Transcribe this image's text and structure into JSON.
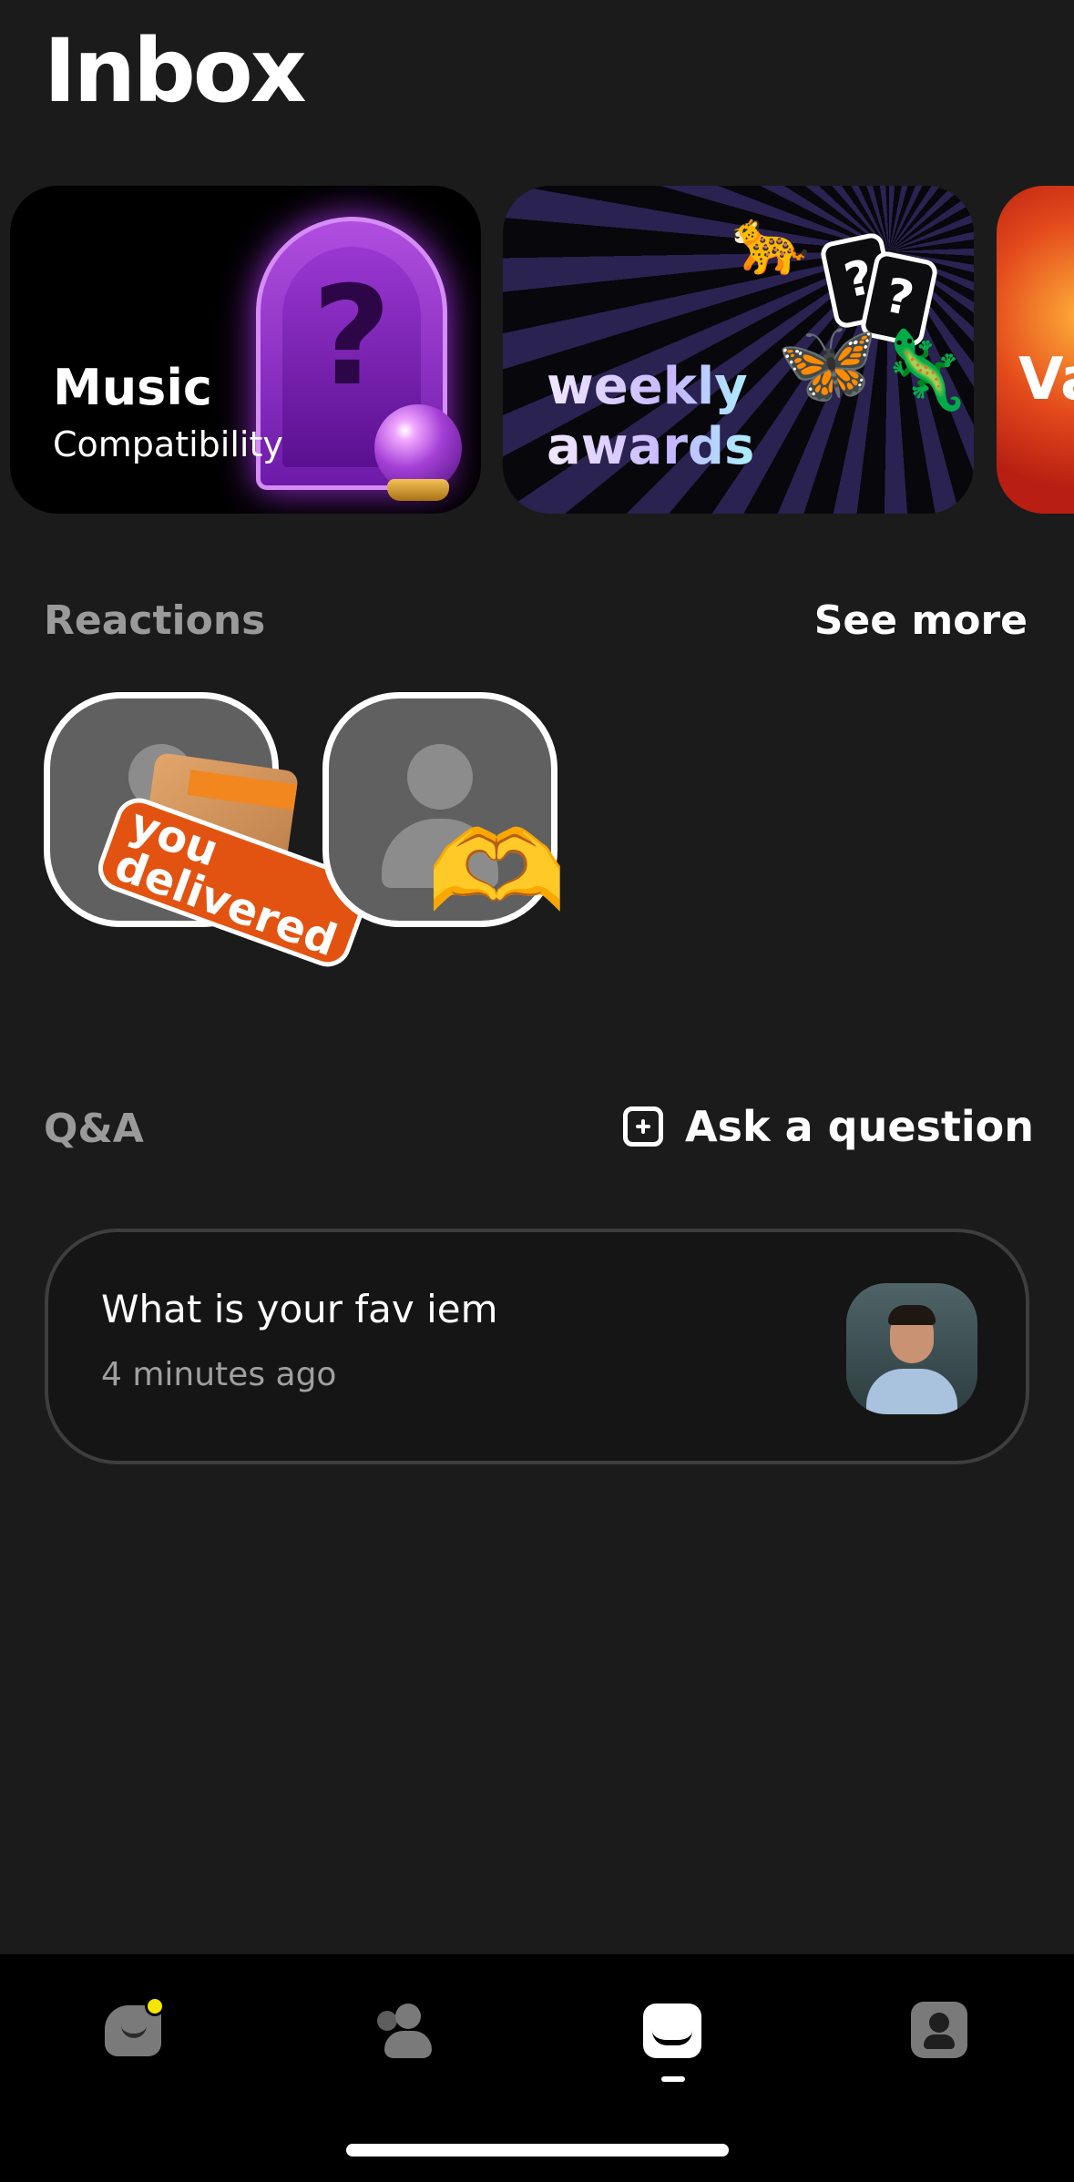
{
  "header": {
    "title": "Inbox"
  },
  "cards": [
    {
      "title": "Music",
      "subtitle": "Compatibility",
      "icon": "question-arch-icon"
    },
    {
      "title": "weekly awards",
      "title_line1": "weekly",
      "title_line2": "awards",
      "icon": "question-cards-icon"
    },
    {
      "title_partial": "Va"
    }
  ],
  "reactions": {
    "label": "Reactions",
    "see_more": "See more",
    "items": [
      {
        "sticker": "you delivered",
        "sticker_line1": "you",
        "sticker_line2": "delivered",
        "icon": "amazon-box-icon"
      },
      {
        "sticker_emoji": "🫶",
        "icon": "heart-hands-icon"
      }
    ]
  },
  "qa": {
    "label": "Q&A",
    "ask_label": "Ask a question",
    "items": [
      {
        "question": "What is your fav iem",
        "time": "4 minutes ago"
      }
    ]
  },
  "nav": {
    "items": [
      {
        "name": "home",
        "icon": "home-icon",
        "badge": true
      },
      {
        "name": "friends",
        "icon": "friends-icon"
      },
      {
        "name": "inbox",
        "icon": "inbox-icon",
        "active": true
      },
      {
        "name": "profile",
        "icon": "profile-icon"
      }
    ]
  },
  "colors": {
    "background": "#1b1b1b",
    "nav_background": "#000000",
    "badge": "#f5e500",
    "muted_text": "#9a9a9a"
  }
}
